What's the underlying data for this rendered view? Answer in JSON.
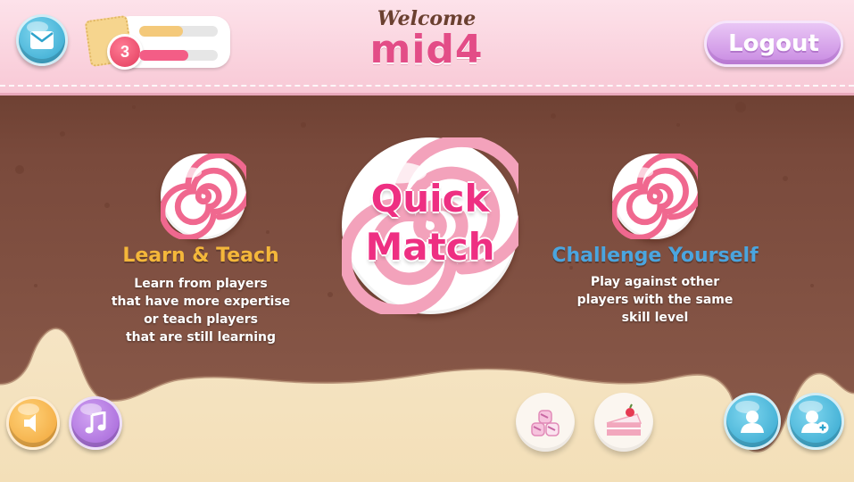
{
  "header": {
    "welcome_label": "Welcome",
    "username": "mid4",
    "logout_label": "Logout"
  },
  "player": {
    "level": "3",
    "xp_fraction": 0.56,
    "hp_fraction": 0.62
  },
  "modes": {
    "learn": {
      "title": "Learn & Teach",
      "desc": [
        "Learn from players",
        "that have more expertise",
        "or teach players",
        "that are still learning"
      ]
    },
    "quick": {
      "line1": "Quick",
      "line2": "Match"
    },
    "challenge": {
      "title": "Challenge Yourself",
      "desc": [
        "Play against other",
        "players with the same",
        "skill level"
      ]
    }
  },
  "colors": {
    "chocolate": "#7a4a3c",
    "cream": "#f7ead0",
    "pink_header": "#f8c9d6",
    "learn_title": "#f4b73a",
    "challenge_title": "#4aa5df",
    "quick_match": "#ee2f82"
  },
  "icons": {
    "mail": "envelope",
    "sound": "speaker",
    "music": "music-note",
    "profile": "user",
    "add_friend": "user-plus",
    "marshmallow": "marshmallow",
    "cake": "cake-slice"
  }
}
